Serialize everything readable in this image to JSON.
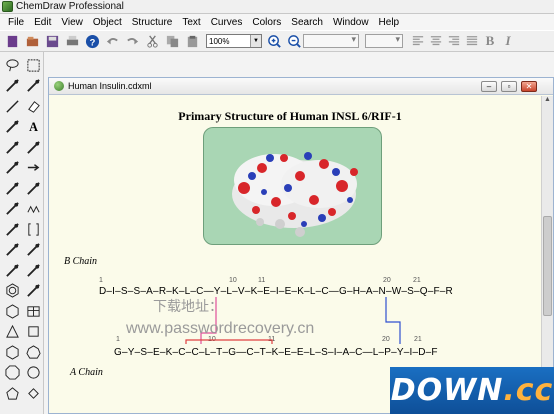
{
  "app": {
    "title": "ChemDraw Professional"
  },
  "menu": [
    "File",
    "Edit",
    "View",
    "Object",
    "Structure",
    "Text",
    "Curves",
    "Colors",
    "Search",
    "Window",
    "Help"
  ],
  "toolbar": {
    "zoom": "100%"
  },
  "document": {
    "title": "Human Insulin.cdxml",
    "heading": "Primary Structure of Human INSL 6/RIF-1",
    "b_chain": {
      "label": "B Chain",
      "sequence": "D–I–S–S–A–R–K–L–C—Y–L–V–K–E–I–E–K–L–C—G–H–A–N–W–S–Q–F–R",
      "numbers": [
        "1",
        "10",
        "11",
        "20",
        "21"
      ]
    },
    "a_chain": {
      "label": "A Chain",
      "sequence": "G–Y–S–E–K–C–C–L–T–G—C–T–K–E–E–L–S–I–A–C—L–P–Y–I–D–F",
      "numbers": [
        "1",
        "10",
        "11",
        "20",
        "21"
      ]
    },
    "watermark_cn": "下载地址：",
    "watermark_url": "www.passwordrecovery.cn"
  },
  "logo": {
    "main": "DOWN",
    "suffix": ".cc"
  },
  "colors": {
    "disulfide_pink": "#e0509a",
    "disulfide_red": "#e04040",
    "disulfide_blue": "#3050d0"
  }
}
